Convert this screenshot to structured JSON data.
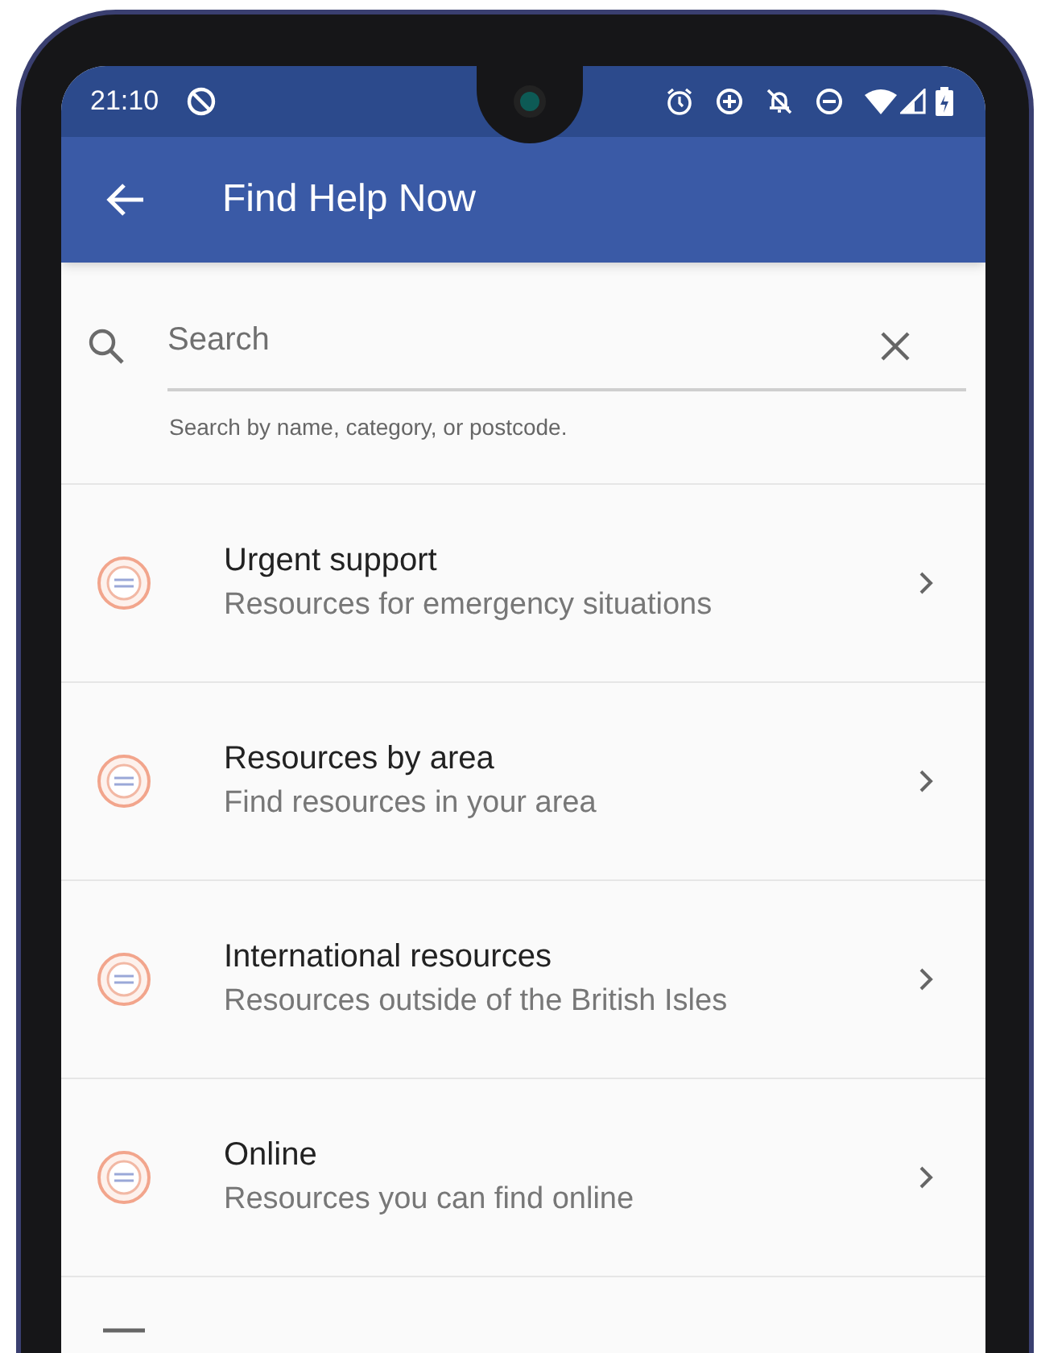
{
  "status_bar": {
    "time": "21:10"
  },
  "app_bar": {
    "title": "Find Help Now"
  },
  "search": {
    "placeholder": "Search",
    "helper": "Search by name, category, or postcode."
  },
  "items": [
    {
      "title": "Urgent support",
      "subtitle": "Resources for emergency situations"
    },
    {
      "title": "Resources by area",
      "subtitle": "Find resources in your area"
    },
    {
      "title": "International resources",
      "subtitle": "Resources outside of the British Isles"
    },
    {
      "title": "Online",
      "subtitle": "Resources you can find online"
    }
  ]
}
